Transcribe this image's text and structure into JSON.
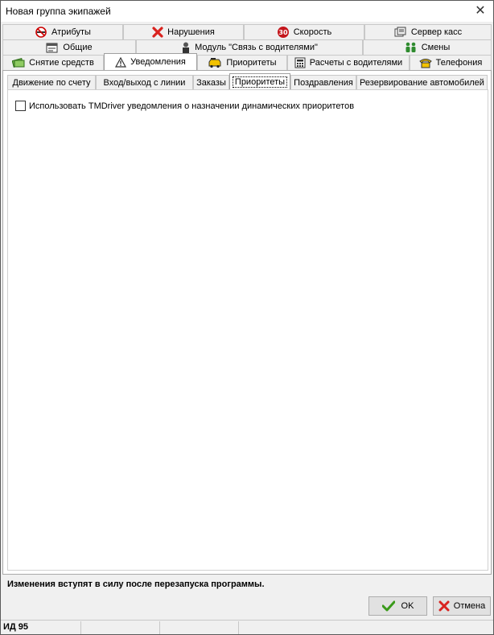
{
  "window": {
    "title": "Новая группа экипажей",
    "close_glyph": "✕"
  },
  "tabs": {
    "row1": [
      {
        "label": "Атрибуты",
        "icon": "no-smoking-icon"
      },
      {
        "label": "Нарушения",
        "icon": "red-x-icon"
      },
      {
        "label": "Скорость",
        "icon": "speed-limit-30-icon"
      },
      {
        "label": "Сервер касс",
        "icon": "cash-server-icon"
      }
    ],
    "row2": [
      {
        "label": "Общие",
        "icon": "properties-icon"
      },
      {
        "label": "Модуль \"Связь с водителями\"",
        "icon": "driver-icon"
      },
      {
        "label": "Смены",
        "icon": "people-icon"
      }
    ],
    "row3": [
      {
        "label": "Снятие средств",
        "icon": "money-icon"
      },
      {
        "label": "Уведомления",
        "icon": "warning-icon",
        "active": true
      },
      {
        "label": "Приоритеты",
        "icon": "taxi-icon"
      },
      {
        "label": "Расчеты с водителями",
        "icon": "calculator-icon"
      },
      {
        "label": "Телефония",
        "icon": "phone-icon"
      }
    ]
  },
  "subtabs": [
    {
      "label": "Движение по счету"
    },
    {
      "label": "Вход/выход с линии"
    },
    {
      "label": "Заказы"
    },
    {
      "label": "Приоритеты",
      "active": true
    },
    {
      "label": "Поздравления"
    },
    {
      "label": "Резервирование автомобилей"
    }
  ],
  "options": {
    "use_tmdriver_label": "Использовать TMDriver уведомления о назначении динамических приоритетов",
    "use_tmdriver_checked": false
  },
  "footer": {
    "restart_notice": "Изменения вступят в силу после перезапуска программы.",
    "ok_label": "OK",
    "cancel_label": "Отмена"
  },
  "statusbar": {
    "id_text": "ИД 95"
  },
  "colors": {
    "accent_green": "#3a9a1a",
    "cancel_red": "#d9231f",
    "taxi_yellow": "#f2c200"
  }
}
